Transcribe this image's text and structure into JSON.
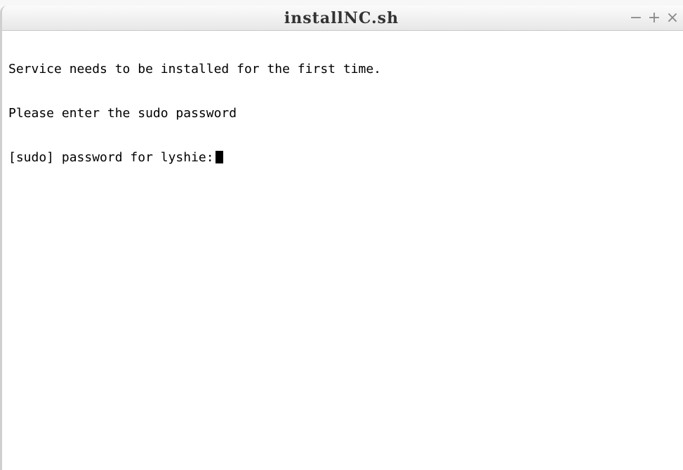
{
  "window": {
    "title": "installNC.sh"
  },
  "controls": {
    "minimize_glyph": "−",
    "maximize_glyph": "+",
    "close_glyph": "×",
    "icons": [
      "minimize-icon",
      "maximize-icon",
      "close-icon"
    ]
  },
  "terminal": {
    "lines": [
      "Service needs to be installed for the first time.",
      "Please enter the sudo password",
      "[sudo] password for lyshie:"
    ]
  }
}
